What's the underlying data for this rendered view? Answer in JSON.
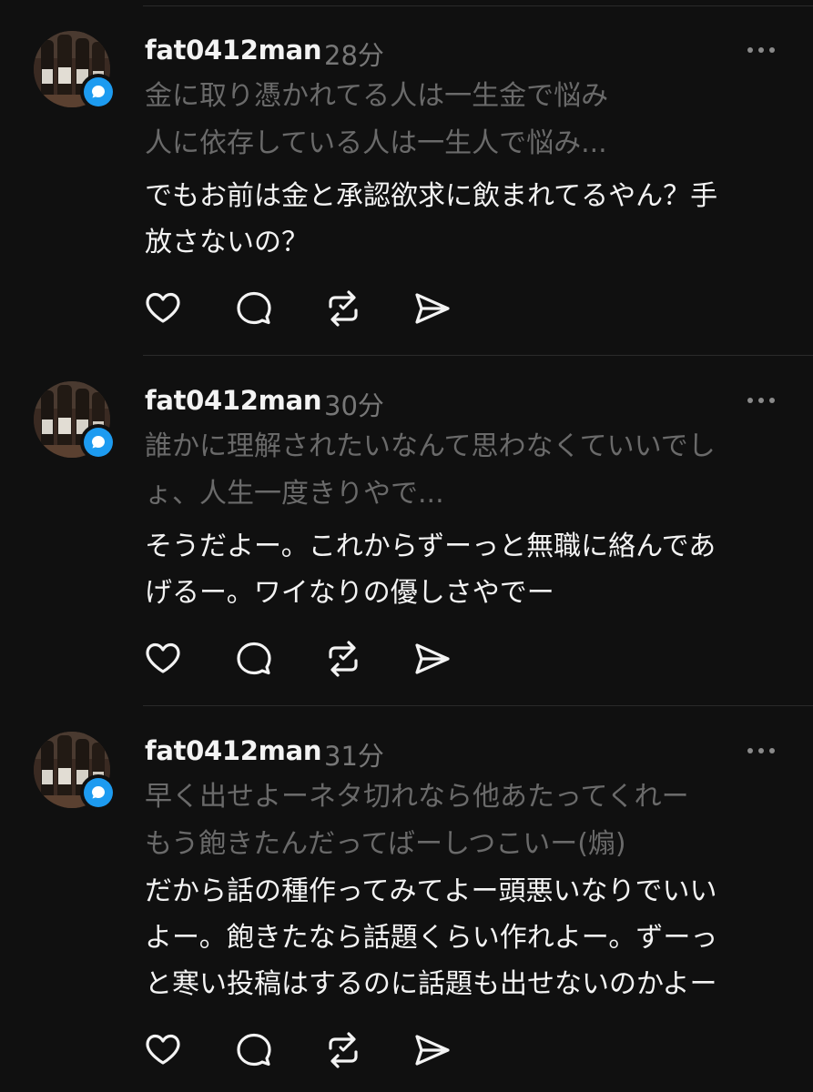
{
  "posts": [
    {
      "username": "fat0412man",
      "time": "28分",
      "quote_lines": [
        "金に取り憑かれてる人は一生金で悩み",
        "人に依存している人は一生人で悩み..."
      ],
      "body_lines": [
        "でもお前は金と承認欲求に飲まれてるやん？手",
        "放さないの？"
      ]
    },
    {
      "username": "fat0412man",
      "time": "30分",
      "quote_lines": [
        "誰かに理解されたいなんて思わなくていいでし",
        "ょ、人生一度きりやで..."
      ],
      "body_lines": [
        "そうだよー。これからずーっと無職に絡んであ",
        "げるー。ワイなりの優しさやでー"
      ]
    },
    {
      "username": "fat0412man",
      "time": "31分",
      "quote_lines": [
        "早く出せよーネタ切れなら他あたってくれー",
        "もう飽きたんだってばーしつこいー(煽)"
      ],
      "body_lines": [
        "だから話の種作ってみてよー頭悪いなりでいい",
        "よー。飽きたなら話題くらい作れよー。ずーっ",
        "と寒い投稿はするのに話題も出せないのかよー"
      ]
    }
  ],
  "icons": {
    "like": "heart-icon",
    "reply": "speech-bubble-icon",
    "repost": "repost-icon",
    "share": "send-icon",
    "more": "more-horizontal-icon",
    "badge": "chat-bubble-icon"
  },
  "colors": {
    "background": "#101010",
    "primary_text": "#f3f3f3",
    "secondary_text": "#777777",
    "badge": "#1d9bf0"
  }
}
